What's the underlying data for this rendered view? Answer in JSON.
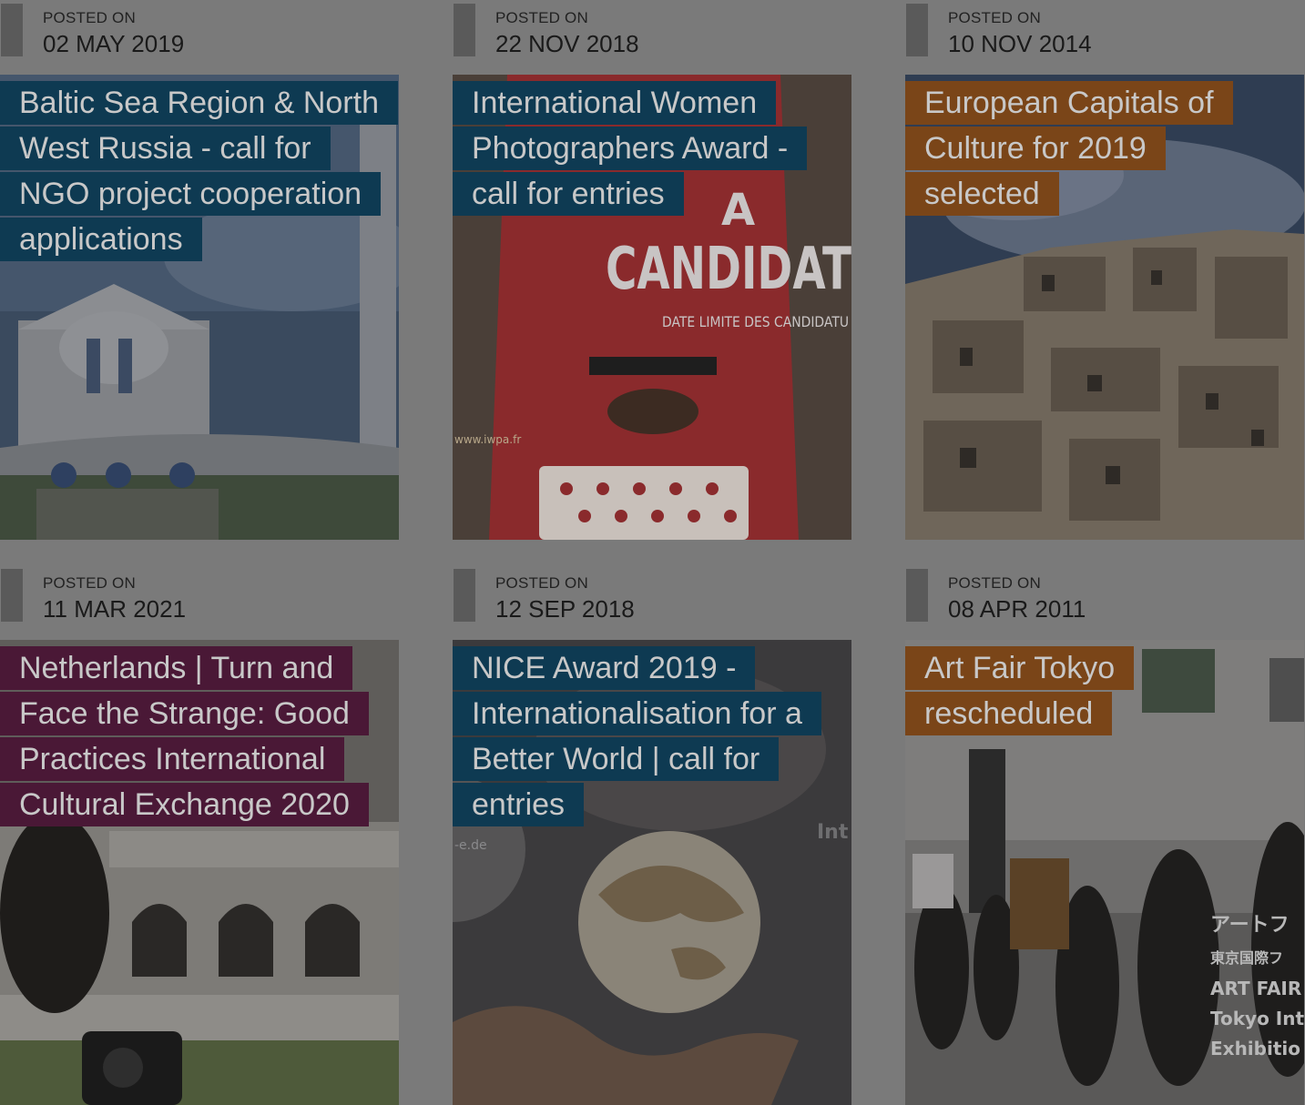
{
  "posted_label": "POSTED ON",
  "posts": [
    {
      "date": "02 MAY 2019",
      "title": "Baltic Sea Region & North West Russia - call for NGO project cooperation applications",
      "category_color": "#0e3a52"
    },
    {
      "date": "22 NOV 2018",
      "title": "International Women Photographers Award - call for entries",
      "category_color": "#0e3a52",
      "image_text": {
        "candidate": "CANDIDAT",
        "deadline": "DATE LIMITE DES CANDIDATU",
        "a": "A",
        "url": "www.iwpa.fr"
      }
    },
    {
      "date": "10 NOV 2014",
      "title": "European Capitals of Culture for 2019 selected",
      "category_color": "#7a4518"
    },
    {
      "date": "11 MAR 2021",
      "title": "Netherlands | Turn and Face the Strange: Good Practices International Cultural Exchange 2020",
      "category_color": "#4a1836"
    },
    {
      "date": "12 SEP 2018",
      "title": "NICE Award 2019 - Internationalisation for a Better World | call for entries",
      "category_color": "#0e3a52",
      "image_text": {
        "int": "Int",
        "e": "-e.de"
      }
    },
    {
      "date": "08 APR 2011",
      "title": "Art Fair Tokyo rescheduled",
      "category_color": "#7a4518",
      "image_text": {
        "jp1": "アートフ",
        "jp2": "東京国際フ",
        "en1": "ART FAIR",
        "en2": "Tokyo Int",
        "en3": "Exhibitio"
      }
    }
  ]
}
